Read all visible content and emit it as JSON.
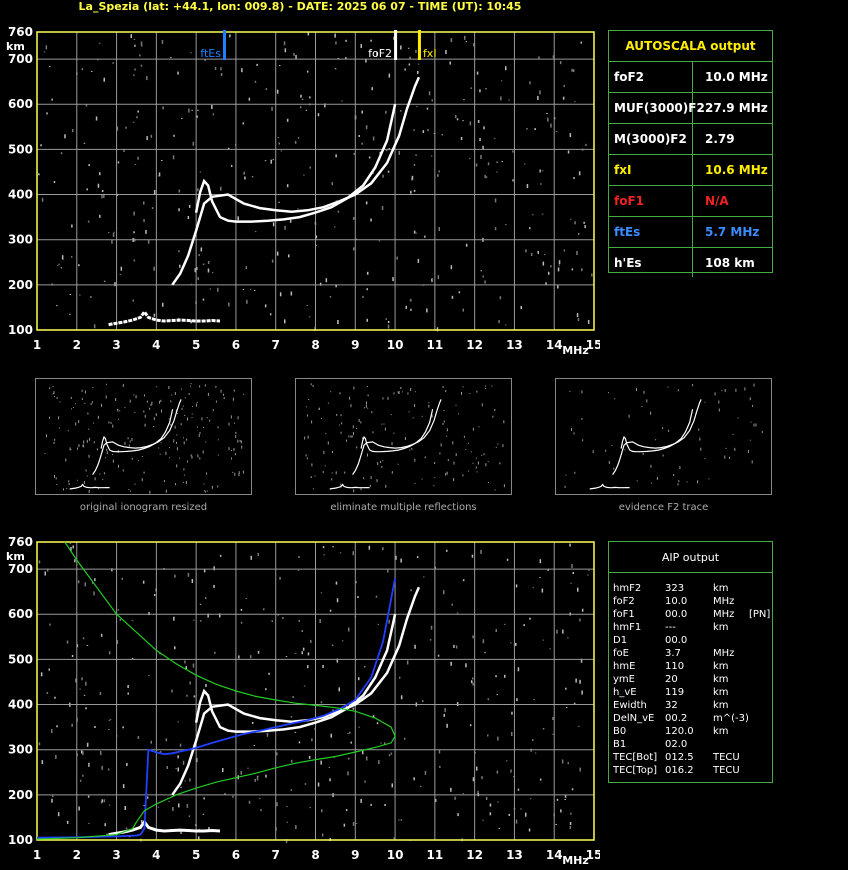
{
  "title": "La_Spezia (lat: +44.1, lon: 009.8) - DATE: 2025 06 07 - TIME (UT): 10:45",
  "colors": {
    "axis": "#ffff55",
    "grid": "#9a9a9a",
    "trace": "#ffffff",
    "blue": "#2040ff",
    "green": "#22cc22",
    "auto_header": "#ffee00",
    "red": "#ee2222",
    "ltblue": "#3a8cff"
  },
  "axis": {
    "km_label": "km",
    "mhz_label": "MHz",
    "y_ticks": [
      "760",
      "700",
      "600",
      "500",
      "400",
      "300",
      "200",
      "100"
    ],
    "x_ticks": [
      "1",
      "2",
      "3",
      "4",
      "5",
      "6",
      "7",
      "8",
      "9",
      "10",
      "11",
      "12",
      "13",
      "14",
      "15"
    ]
  },
  "markers": {
    "ftEs": {
      "label": "ftEs",
      "freq": 5.7,
      "color": "#2080ff"
    },
    "foF2": {
      "label": "foF2",
      "freq": 10.0,
      "color": "#ffffff"
    },
    "fxI": {
      "label": "fxI",
      "freq": 10.6,
      "color": "#ffee00"
    }
  },
  "autoscala": {
    "header": "AUTOSCALA output",
    "rows": [
      {
        "key": "foF2",
        "value": "10.0 MHz",
        "kcolor": "#ffffff",
        "vcolor": "#ffffff"
      },
      {
        "key": "MUF(3000)F2",
        "value": "27.9 MHz",
        "kcolor": "#ffffff",
        "vcolor": "#ffffff"
      },
      {
        "key": "M(3000)F2",
        "value": "2.79",
        "kcolor": "#ffffff",
        "vcolor": "#ffffff"
      },
      {
        "key": "fxI",
        "value": "10.6 MHz",
        "kcolor": "#ffee00",
        "vcolor": "#ffee00"
      },
      {
        "key": "foF1",
        "value": "N/A",
        "kcolor": "#ee2222",
        "vcolor": "#ee2222"
      },
      {
        "key": "ftEs",
        "value": "5.7 MHz",
        "kcolor": "#3a8cff",
        "vcolor": "#3a8cff"
      },
      {
        "key": "h'Es",
        "value": "108     km",
        "kcolor": "#ffffff",
        "vcolor": "#ffffff"
      }
    ]
  },
  "thumbnails": [
    {
      "caption": "original ionogram resized"
    },
    {
      "caption": "eliminate multiple reflections"
    },
    {
      "caption": "evidence F2 trace"
    }
  ],
  "aip": {
    "header": "AIP output",
    "rows": [
      [
        "hmF2",
        "323",
        "km",
        ""
      ],
      [
        "foF2",
        "10.0",
        "MHz",
        ""
      ],
      [
        "foF1",
        "00.0",
        "MHz",
        "[PN]"
      ],
      [
        "hmF1",
        "---",
        "km",
        ""
      ],
      [
        "D1",
        "00.0",
        "",
        ""
      ],
      [
        "foE",
        "3.7",
        "MHz",
        ""
      ],
      [
        "hmE",
        "110",
        "km",
        ""
      ],
      [
        "ymE",
        "20",
        "km",
        ""
      ],
      [
        "h_vE",
        "119",
        "km",
        ""
      ],
      [
        "Ewidth",
        "32",
        "km",
        ""
      ],
      [
        "DelN_vE",
        "00.2",
        "m^(-3)",
        ""
      ],
      [
        "B0",
        "120.0",
        "km",
        ""
      ],
      [
        "B1",
        "02.0",
        "",
        ""
      ],
      [
        "TEC[Bot]",
        "012.5",
        "TECU",
        ""
      ],
      [
        "TEC[Top]",
        "016.2",
        "TECU",
        ""
      ]
    ]
  },
  "chart_data": [
    {
      "type": "scatter",
      "title": "",
      "xlabel": "MHz",
      "ylabel": "km",
      "xlim": [
        1,
        15
      ],
      "ylim": [
        100,
        760
      ],
      "grid": true,
      "series": [
        {
          "values_x": [
            5.0,
            5.1,
            5.2,
            5.3,
            5.4,
            5.6,
            5.8,
            6.0,
            6.4,
            6.8,
            7.2,
            7.6,
            8.0,
            8.4,
            8.8,
            9.2,
            9.5,
            9.8,
            10.0
          ],
          "values_y": [
            360,
            405,
            430,
            420,
            385,
            350,
            342,
            340,
            340,
            342,
            345,
            350,
            360,
            372,
            392,
            420,
            460,
            520,
            600
          ]
        },
        {
          "values_x": [
            4.4,
            4.6,
            4.8,
            5.0,
            5.2,
            5.4,
            5.8,
            6.0,
            6.2,
            6.6,
            7.0,
            7.4,
            7.8,
            8.2,
            8.6,
            9.0,
            9.4,
            9.8,
            10.1,
            10.3,
            10.5,
            10.6
          ],
          "values_y": [
            200,
            225,
            265,
            320,
            380,
            395,
            400,
            390,
            380,
            370,
            365,
            362,
            365,
            372,
            385,
            400,
            425,
            470,
            530,
            590,
            640,
            660
          ]
        },
        {
          "values_x": [
            2.8,
            3.0,
            3.2,
            3.4,
            3.6,
            3.7,
            3.8,
            4.0,
            4.2,
            4.4,
            4.6,
            4.8,
            5.0,
            5.2,
            5.4,
            5.6
          ],
          "values_y": [
            112,
            115,
            118,
            122,
            128,
            140,
            128,
            122,
            120,
            121,
            122,
            121,
            120,
            120,
            121,
            120
          ]
        }
      ]
    },
    {
      "type": "line",
      "title": "",
      "xlabel": "MHz",
      "ylabel": "km",
      "xlim": [
        1,
        15
      ],
      "ylim": [
        100,
        760
      ],
      "grid": true,
      "series": [
        {
          "values_x": [
            1.0,
            2.0,
            3.0,
            3.5,
            3.6,
            3.7,
            3.8,
            4.0,
            4.2,
            4.4,
            4.6,
            4.8,
            5.0,
            5.4,
            5.8,
            6.2,
            6.6,
            7.0,
            7.4,
            7.8,
            8.2,
            8.6,
            9.0,
            9.4,
            9.7,
            10.0
          ],
          "values_y": [
            105,
            106,
            108,
            110,
            112,
            125,
            300,
            294,
            290,
            292,
            296,
            300,
            304,
            315,
            325,
            335,
            342,
            350,
            358,
            365,
            375,
            390,
            410,
            460,
            540,
            680
          ]
        },
        {
          "values_x": [
            1.7,
            2.0,
            2.5,
            3.0,
            3.5,
            4.0,
            4.5,
            5.0,
            5.5,
            6.0,
            6.5,
            7.0,
            7.5,
            8.0,
            8.5,
            9.0,
            9.5,
            9.9,
            10.0,
            9.9,
            9.5,
            9.0,
            8.5,
            8.0,
            7.5,
            7.0,
            6.5,
            6.0,
            5.5,
            5.0,
            4.5,
            4.0,
            3.7,
            3.5,
            3.4,
            3.0,
            2.0,
            1.0
          ],
          "values_y": [
            760,
            720,
            660,
            600,
            560,
            520,
            490,
            465,
            445,
            430,
            418,
            410,
            403,
            398,
            393,
            385,
            370,
            350,
            330,
            315,
            305,
            295,
            285,
            278,
            270,
            260,
            248,
            238,
            228,
            215,
            200,
            180,
            165,
            140,
            125,
            112,
            105,
            102
          ]
        }
      ]
    }
  ]
}
